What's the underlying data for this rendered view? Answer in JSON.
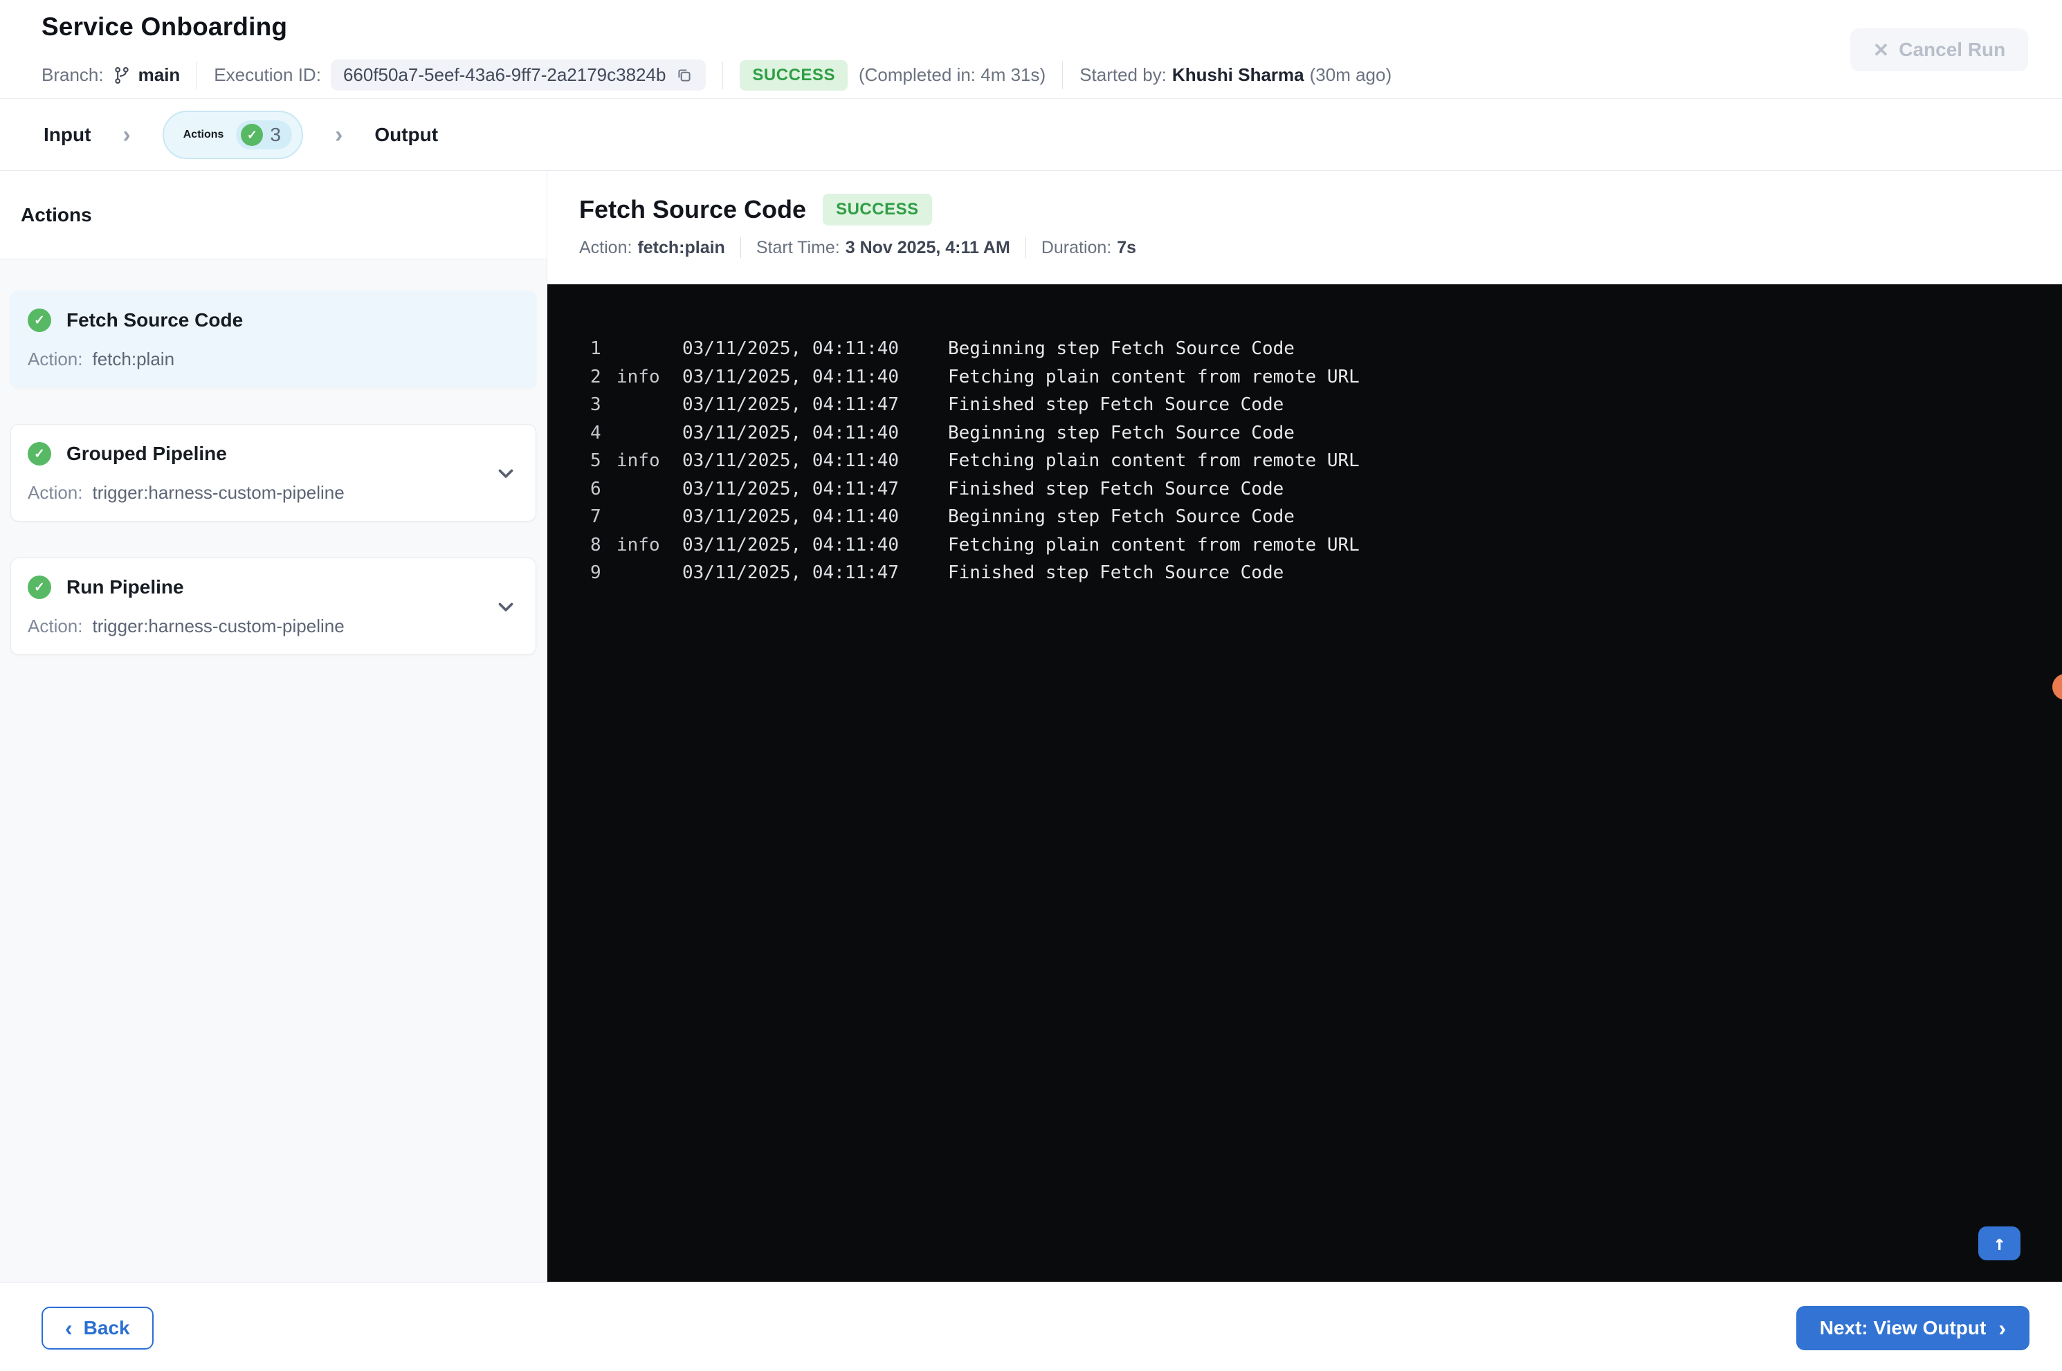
{
  "header": {
    "title": "Service Onboarding",
    "branch_label": "Branch:",
    "branch_name": "main",
    "execution_id_label": "Execution ID:",
    "execution_id": "660f50a7-5eef-43a6-9ff7-2a2179c3824b",
    "status": "SUCCESS",
    "completed_in": "(Completed in: 4m 31s)",
    "started_by_label": "Started by:",
    "started_by_name": "Khushi Sharma",
    "started_ago": "(30m ago)",
    "cancel_label": "Cancel Run"
  },
  "stepper": {
    "steps": [
      {
        "label": "Input"
      },
      {
        "label": "Actions",
        "count": "3",
        "active": true
      },
      {
        "label": "Output"
      }
    ]
  },
  "sidebar": {
    "heading": "Actions",
    "action_label": "Action:",
    "items": [
      {
        "title": "Fetch Source Code",
        "action": "fetch:plain",
        "selected": true,
        "expandable": false
      },
      {
        "title": "Grouped Pipeline",
        "action": "trigger:harness-custom-pipeline",
        "selected": false,
        "expandable": true
      },
      {
        "title": "Run Pipeline",
        "action": "trigger:harness-custom-pipeline",
        "selected": false,
        "expandable": true
      }
    ]
  },
  "detail": {
    "title": "Fetch Source Code",
    "status": "SUCCESS",
    "meta": [
      {
        "label": "Action:",
        "value": "fetch:plain"
      },
      {
        "label": "Start Time:",
        "value": "3 Nov 2025, 4:11 AM"
      },
      {
        "label": "Duration:",
        "value": "7s"
      }
    ]
  },
  "console": {
    "lines": [
      {
        "num": "1",
        "level": "",
        "time": "03/11/2025, 04:11:40",
        "message": "Beginning step Fetch Source Code"
      },
      {
        "num": "2",
        "level": "info",
        "time": "03/11/2025, 04:11:40",
        "message": "Fetching plain content from remote URL"
      },
      {
        "num": "3",
        "level": "",
        "time": "03/11/2025, 04:11:47",
        "message": "Finished step Fetch Source Code"
      },
      {
        "num": "4",
        "level": "",
        "time": "03/11/2025, 04:11:40",
        "message": "Beginning step Fetch Source Code"
      },
      {
        "num": "5",
        "level": "info",
        "time": "03/11/2025, 04:11:40",
        "message": "Fetching plain content from remote URL"
      },
      {
        "num": "6",
        "level": "",
        "time": "03/11/2025, 04:11:47",
        "message": "Finished step Fetch Source Code"
      },
      {
        "num": "7",
        "level": "",
        "time": "03/11/2025, 04:11:40",
        "message": "Beginning step Fetch Source Code"
      },
      {
        "num": "8",
        "level": "info",
        "time": "03/11/2025, 04:11:40",
        "message": "Fetching plain content from remote URL"
      },
      {
        "num": "9",
        "level": "",
        "time": "03/11/2025, 04:11:47",
        "message": "Finished step Fetch Source Code"
      }
    ]
  },
  "footer": {
    "back_label": "Back",
    "next_label": "Next: View Output"
  },
  "icons": {
    "close_x": "✕",
    "chevron_right": "›",
    "chevron_left": "‹",
    "arrow_up": "↑",
    "check": "✓"
  },
  "colors": {
    "accent_blue": "#3273d3",
    "success_green": "#2f9e44",
    "success_badge_bg": "#def3e0",
    "check_circle_green": "#57b964",
    "active_step_bg": "#e9f7fd",
    "active_step_border": "#c9e7f4",
    "selected_card_bg": "#edf6fc",
    "sidebar_bg": "#f7f9fb",
    "console_bg": "#0a0b0c",
    "orange_indicator": "#ea7b50",
    "disabled_text": "#b9bfca"
  }
}
